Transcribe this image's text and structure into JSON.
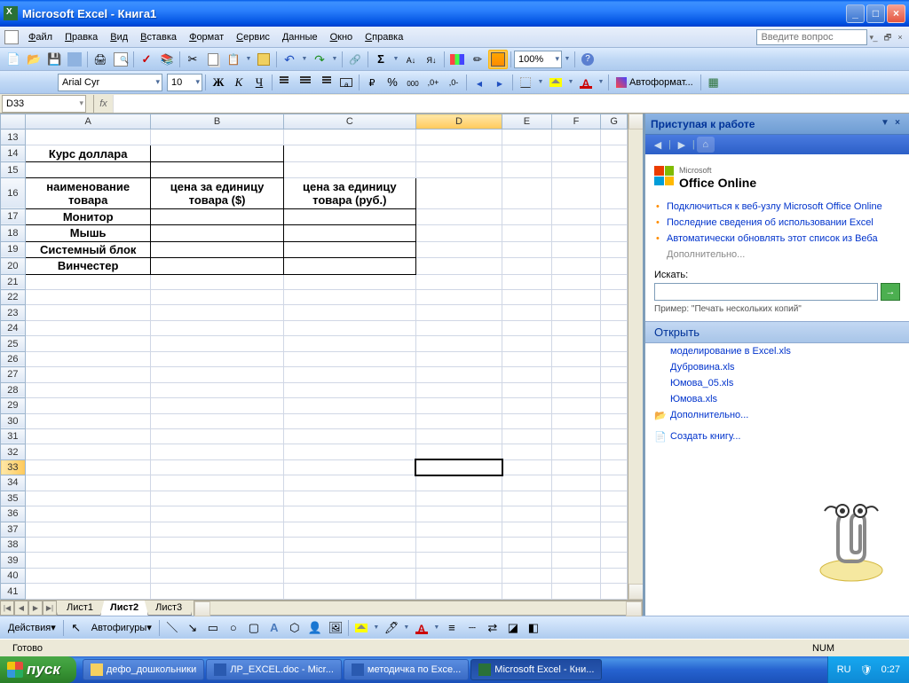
{
  "title": "Microsoft Excel - Книга1",
  "menu": [
    "Файл",
    "Правка",
    "Вид",
    "Вставка",
    "Формат",
    "Сервис",
    "Данные",
    "Окно",
    "Справка"
  ],
  "ask_placeholder": "Введите вопрос",
  "font_name": "Arial Cyr",
  "font_size": "10",
  "zoom": "100%",
  "autoformat_label": "Автоформат...",
  "namebox": "D33",
  "columns": [
    "A",
    "B",
    "C",
    "D",
    "E",
    "F"
  ],
  "selected_col": "D",
  "selected_row": 33,
  "rows_start": 13,
  "rows_end": 41,
  "cells": {
    "A14": "Курс доллара",
    "A16": "наименование товара",
    "B16": "цена за единицу товара ($)",
    "C16": "цена за единицу товара (руб.)",
    "A17": "Монитор",
    "A18": "Мышь",
    "A19": "Системный блок",
    "A20": "Винчестер"
  },
  "col_widths": {
    "A": 142,
    "B": 150,
    "C": 150,
    "D": 98,
    "E": 56,
    "F": 56,
    "G": 30
  },
  "row_heights": {
    "14": 19,
    "16": 34
  },
  "sheets": [
    "Лист1",
    "Лист2",
    "Лист3"
  ],
  "active_sheet": 1,
  "drawbar": {
    "actions": "Действия",
    "autoshapes": "Автофигуры"
  },
  "status": {
    "ready": "Готово",
    "num": "NUM"
  },
  "taskpane": {
    "title": "Приступая к работе",
    "office_online": "Office Online",
    "microsoft": "Microsoft",
    "links": [
      "Подключиться к веб-узлу Microsoft Office Online",
      "Последние сведения об использовании Excel",
      "Автоматически обновлять этот список из Веба"
    ],
    "more": "Дополнительно...",
    "search_label": "Искать:",
    "example": "Пример: \"Печать нескольких копий\"",
    "open_section": "Открыть",
    "recent": [
      "моделирование в Excel.xls",
      "Дубровина.xls",
      "Юмова_05.xls",
      "Юмова.xls"
    ],
    "open_more": "Дополнительно...",
    "create": "Создать книгу..."
  },
  "taskbar": {
    "start": "пуск",
    "items": [
      {
        "label": "дефо_дошкольники",
        "icon": "#f5d060"
      },
      {
        "label": "ЛР_EXCEL.doc - Micr...",
        "icon": "#2a5ab0"
      },
      {
        "label": "методичка по Exce...",
        "icon": "#2a5ab0"
      },
      {
        "label": "Microsoft Excel - Кни...",
        "icon": "#2a7138",
        "active": true
      }
    ],
    "lang": "RU",
    "time": "0:27"
  }
}
